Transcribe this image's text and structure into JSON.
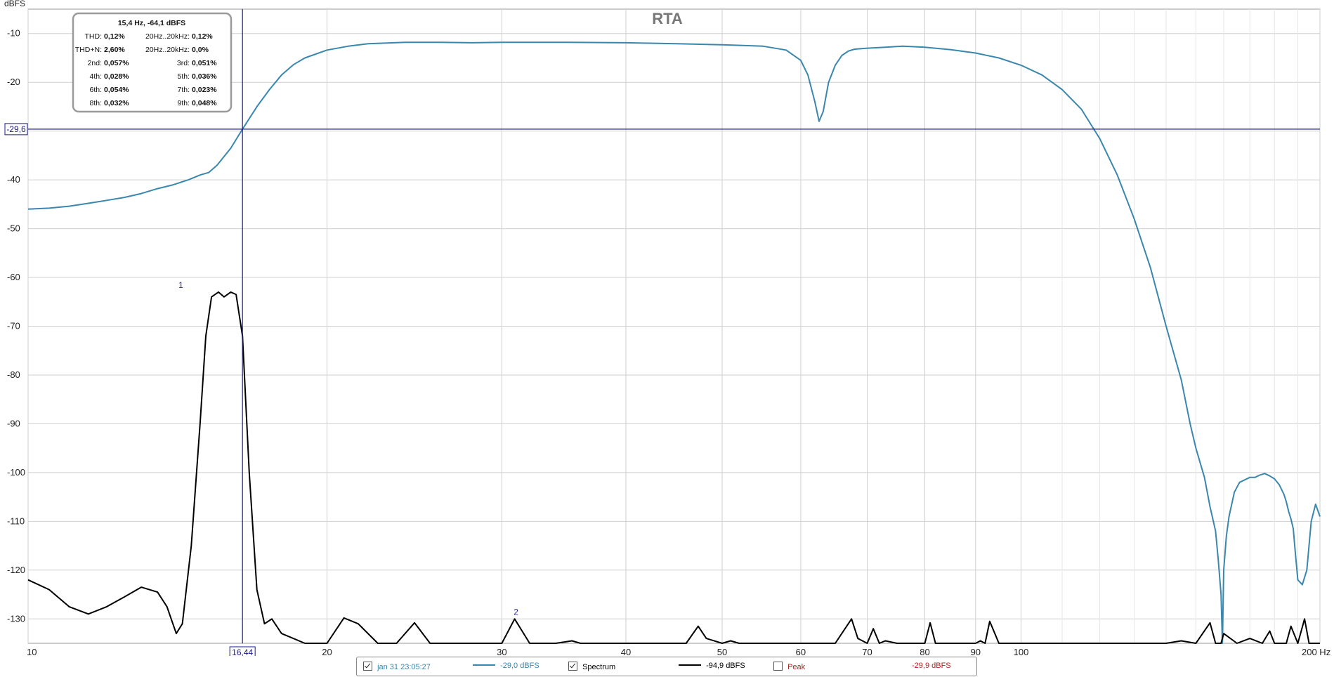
{
  "chart_data": {
    "type": "line",
    "title": "RTA",
    "ylabel": "dBFS",
    "xlabel": "Hz",
    "x_scale": "log",
    "xlim": [
      10,
      200
    ],
    "ylim": [
      -135,
      -5
    ],
    "x_ticks": [
      10,
      20,
      30,
      40,
      50,
      60,
      70,
      80,
      90,
      100,
      200
    ],
    "x_tick_labels": [
      "10",
      "20",
      "30",
      "40",
      "50",
      "60",
      "70",
      "80",
      "90",
      "100",
      "200 Hz"
    ],
    "y_ticks": [
      -10,
      -20,
      -30,
      -40,
      -50,
      -60,
      -70,
      -80,
      -90,
      -100,
      -110,
      -120,
      -130
    ],
    "y_tick_labels": [
      "-10",
      "-20",
      "-30",
      "-40",
      "-50",
      "-60",
      "-70",
      "-80",
      "-90",
      "-100",
      "-110",
      "-120",
      "-130"
    ],
    "grid": true,
    "colors": {
      "trace": "#3a87ad",
      "spectrum": "#000000",
      "peak": "#b22222",
      "cursor": "#1a1a8c"
    },
    "series": [
      {
        "id": "trace",
        "x": [
          10,
          10.5,
          11,
          11.5,
          12,
          12.5,
          13,
          13.5,
          14,
          14.5,
          14.9,
          15.2,
          15.5,
          16,
          16.44,
          17,
          17.5,
          18,
          18.5,
          19,
          20,
          21,
          22,
          24,
          26,
          28,
          30,
          32,
          35,
          40,
          45,
          50,
          55,
          58,
          60,
          61,
          62,
          62.6,
          63.2,
          64,
          65,
          66,
          67,
          68,
          70,
          73,
          76,
          80,
          85,
          90,
          95,
          100,
          105,
          110,
          115,
          120,
          125,
          130,
          135,
          140,
          145,
          148,
          150,
          153,
          155,
          157,
          158,
          159,
          159.5,
          160,
          161,
          162,
          164,
          166,
          170,
          172,
          174,
          176,
          178,
          180,
          182,
          184,
          185,
          186,
          187,
          188,
          189,
          190,
          192,
          194,
          196,
          198,
          200
        ],
        "y": [
          -46,
          -45.8,
          -45.4,
          -44.8,
          -44.2,
          -43.6,
          -42.8,
          -41.8,
          -41,
          -40,
          -39,
          -38.5,
          -37,
          -33.5,
          -29.6,
          -25,
          -21.5,
          -18.5,
          -16.4,
          -15,
          -13.4,
          -12.6,
          -12.1,
          -11.8,
          -11.8,
          -11.9,
          -11.8,
          -11.8,
          -11.8,
          -11.9,
          -12.1,
          -12.3,
          -12.6,
          -13.4,
          -15.5,
          -18.5,
          -24,
          -28,
          -26,
          -20,
          -16.5,
          -14.5,
          -13.6,
          -13.2,
          -13,
          -12.8,
          -12.6,
          -12.8,
          -13.3,
          -14,
          -15,
          -16.5,
          -18.5,
          -21.5,
          -25.5,
          -31.5,
          -39,
          -48,
          -58,
          -70,
          -81,
          -90,
          -95,
          -101,
          -107,
          -112,
          -118,
          -125,
          -135,
          -120,
          -113,
          -109,
          -104,
          -102,
          -101,
          -101,
          -100.5,
          -100.2,
          -100.7,
          -101.3,
          -102.5,
          -104.5,
          -106,
          -108,
          -109.5,
          -111.5,
          -117,
          -122,
          -123,
          -120,
          -110,
          -106.5,
          -109
        ]
      },
      {
        "id": "spectrum",
        "x": [
          10,
          10.5,
          11,
          11.5,
          12,
          12.5,
          13,
          13.5,
          13.8,
          14.1,
          14.3,
          14.6,
          14.9,
          15.1,
          15.3,
          15.55,
          15.75,
          16,
          16.2,
          16.44,
          16.7,
          17,
          17.3,
          17.6,
          18,
          19,
          20,
          20.8,
          21.5,
          22.5,
          23.5,
          24.5,
          25.4,
          26.3,
          28,
          30,
          30.9,
          32,
          34,
          35.3,
          36,
          38,
          40,
          42,
          46,
          47.3,
          48.2,
          50,
          51,
          52,
          55,
          60,
          65,
          67.5,
          68.5,
          70,
          71,
          72,
          73,
          75,
          80,
          81,
          82,
          85,
          90,
          91,
          92,
          93,
          95,
          100,
          110,
          130,
          140,
          145,
          150,
          155,
          157,
          159,
          160,
          165,
          170,
          175,
          178,
          180,
          185,
          187,
          190,
          193,
          195,
          200
        ],
        "y": [
          -122,
          -124,
          -127.5,
          -129,
          -127.5,
          -125.5,
          -123.5,
          -124.5,
          -127.5,
          -133,
          -131,
          -115,
          -90,
          -72,
          -64,
          -63,
          -64,
          -63,
          -63.5,
          -72,
          -100,
          -124,
          -131,
          -130,
          -133,
          -136,
          -136,
          -129.8,
          -131,
          -136,
          -136,
          -130.8,
          -135.5,
          -136,
          -136,
          -136,
          -130,
          -136,
          -136,
          -134.5,
          -136,
          -136,
          -136,
          -136,
          -136,
          -131.5,
          -134,
          -136,
          -134.5,
          -136,
          -136,
          -136,
          -136,
          -130,
          -134,
          -136,
          -132,
          -136,
          -134.5,
          -136,
          -136,
          -130.8,
          -136,
          -136,
          -136,
          -134.5,
          -136,
          -130.5,
          -136,
          -136,
          -136,
          -136,
          -136,
          -134.5,
          -136,
          -130.8,
          -136,
          -136,
          -133,
          -136,
          -134,
          -136,
          -132.5,
          -136,
          -135,
          -131.5,
          -136,
          -130,
          -136,
          -136
        ]
      }
    ],
    "markers": [
      {
        "label": "1",
        "x": 14.25,
        "y": -63
      },
      {
        "label": "2",
        "x": 31,
        "y": -130
      }
    ],
    "cursor": {
      "x": 16.44,
      "y": -29.6,
      "x_label": "16,44",
      "y_label": "-29,6"
    }
  },
  "readout": {
    "header": "15,4 Hz, -64,1 dBFS",
    "rows": [
      {
        "l1": "THD:",
        "v1": "0,12%",
        "l2": "20Hz..20kHz:",
        "v2": "0,12%"
      },
      {
        "l1": "THD+N:",
        "v1": "2,60%",
        "l2": "20Hz..20kHz:",
        "v2": "0,0%"
      },
      {
        "l1": "2nd:",
        "v1": "0,057%",
        "l2": "3rd:",
        "v2": "0,051%"
      },
      {
        "l1": "4th:",
        "v1": "0,028%",
        "l2": "5th:",
        "v2": "0,036%"
      },
      {
        "l1": "6th:",
        "v1": "0,054%",
        "l2": "7th:",
        "v2": "0,023%"
      },
      {
        "l1": "8th:",
        "v1": "0,032%",
        "l2": "9th:",
        "v2": "0,048%"
      }
    ]
  },
  "legend": {
    "items": [
      {
        "name": "jan 31 23:05:27",
        "checked": true,
        "value": "-29,0 dBFS",
        "color": "#3a87ad"
      },
      {
        "name": "Spectrum",
        "checked": true,
        "value": "-94,9 dBFS",
        "color": "#000000"
      },
      {
        "name": "Peak",
        "checked": false,
        "value": "-29,9 dBFS",
        "color": "#b22222"
      }
    ]
  }
}
